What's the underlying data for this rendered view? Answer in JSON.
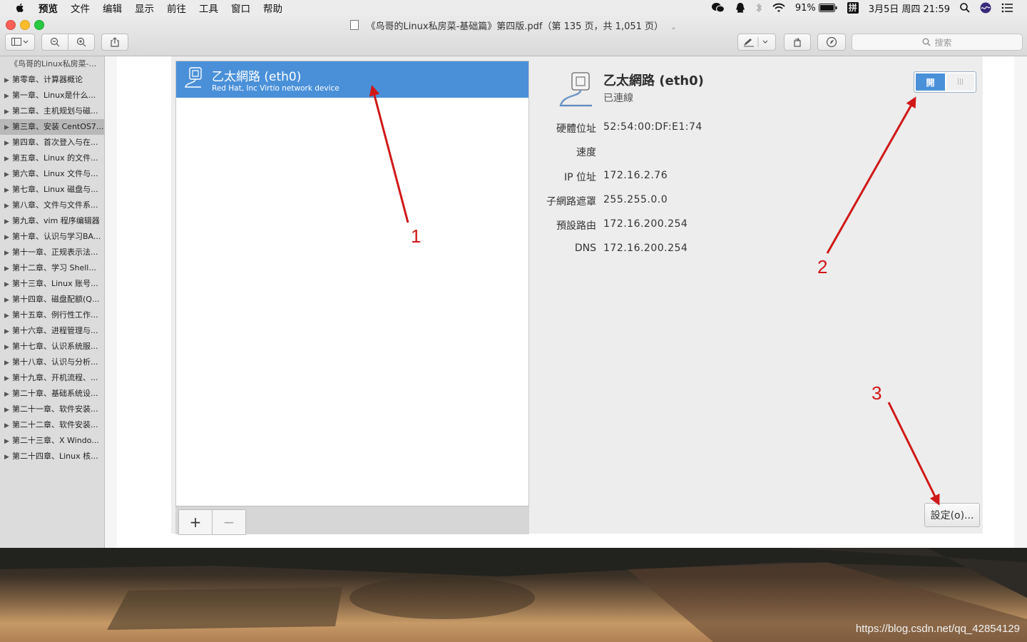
{
  "menubar": {
    "items": [
      "预览",
      "文件",
      "编辑",
      "显示",
      "前往",
      "工具",
      "窗口",
      "帮助"
    ],
    "battery": "91%",
    "input_method": "拼",
    "datetime": "3月5日 周四 21:59"
  },
  "window": {
    "title": "《鸟哥的Linux私房菜-基础篇》第四版.pdf（第 135 页，共 1,051 页）",
    "search_placeholder": "搜索"
  },
  "sidebar": {
    "doc_title": "《鸟哥的Linux私房菜-...",
    "items": [
      "第零章、计算器概论",
      "第一章、Linux是什么...",
      "第二章、主机规划与磁...",
      "第三章、安装 CentOS7...",
      "第四章、首次登入与在...",
      "第五章、Linux 的文件...",
      "第六章、Linux 文件与...",
      "第七章、Linux 磁盘与...",
      "第八章、文件与文件系...",
      "第九章、vim 程序编辑器",
      "第十章、认识与学习BA...",
      "第十一章、正规表示法...",
      "第十二章、学习 Shell...",
      "第十三章、Linux 账号...",
      "第十四章、磁盘配额(Q...",
      "第十五章、例行性工作...",
      "第十六章、进程管理与...",
      "第十七章、认识系统服...",
      "第十八章、认识与分析...",
      "第十九章、开机流程、...",
      "第二十章、基础系统设...",
      "第二十一章、软件安装...",
      "第二十二章、软件安装...",
      "第二十三章、X Windo...",
      "第二十四章、Linux 核..."
    ],
    "selected_index": 3
  },
  "network": {
    "device_name": "乙太網路 (eth0)",
    "device_desc": "Red Hat, Inc Virtio network device",
    "status": "已連線",
    "switch_on_label": "開",
    "details": [
      {
        "label": "硬體位址",
        "value": "52:54:00:DF:E1:74"
      },
      {
        "label": "速度",
        "value": ""
      },
      {
        "label": "IP 位址",
        "value": "172.16.2.76"
      },
      {
        "label": "子網路遮罩",
        "value": "255.255.0.0"
      },
      {
        "label": "預設路由",
        "value": "172.16.200.254"
      },
      {
        "label": "DNS",
        "value": "172.16.200.254"
      }
    ],
    "add_label": "+",
    "remove_label": "−",
    "settings_label": "設定(o)..."
  },
  "annotations": [
    "1",
    "2",
    "3"
  ],
  "watermark": "https://blog.csdn.net/qq_42854129",
  "colors": {
    "selection_blue": "#4a90d9",
    "arrow_red": "#d01818"
  }
}
